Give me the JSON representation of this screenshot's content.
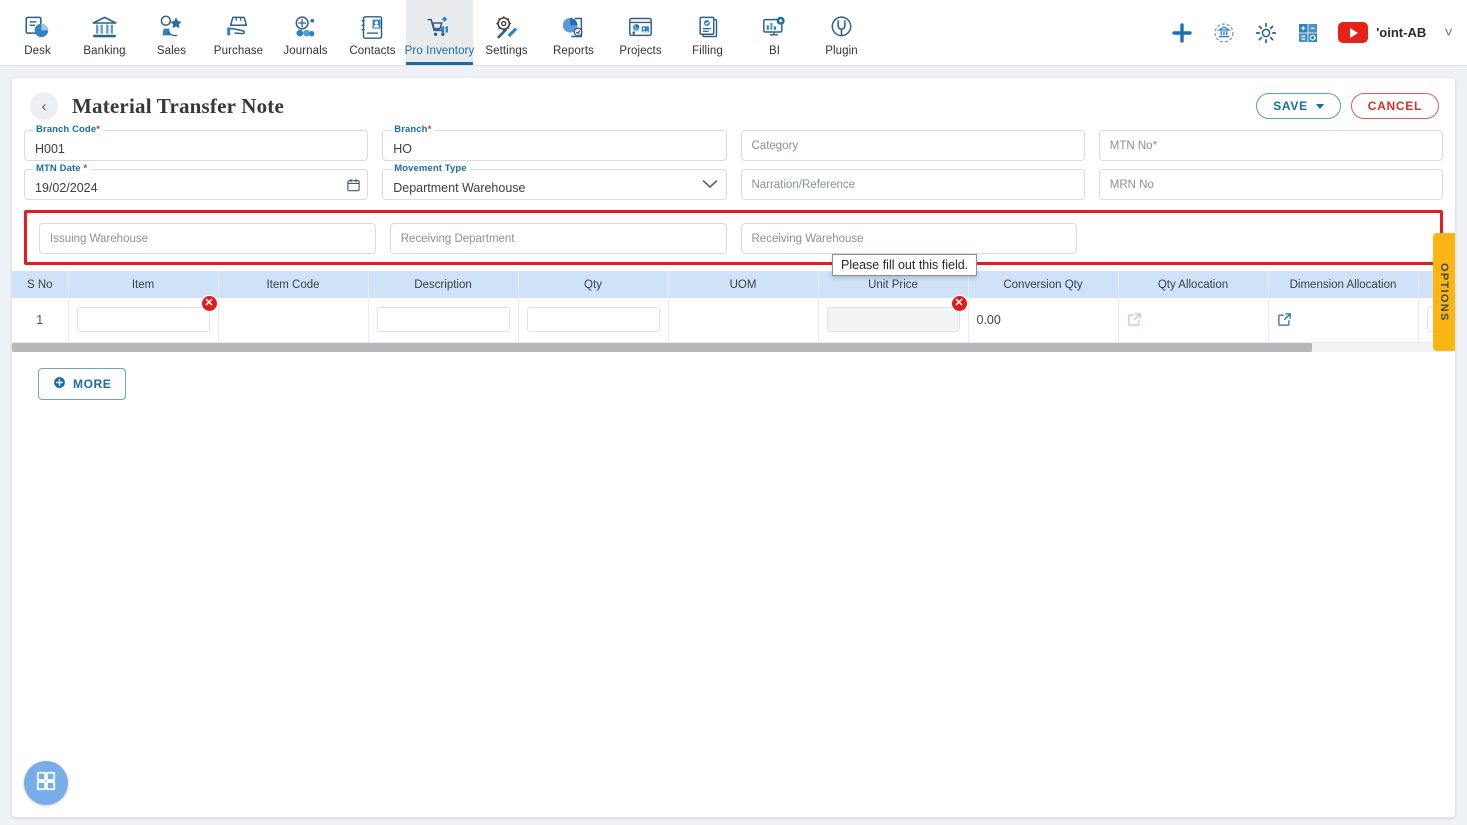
{
  "nav": {
    "items": [
      {
        "label": "Desk",
        "icon": "desk-dashboard-icon"
      },
      {
        "label": "Banking",
        "icon": "bank-icon"
      },
      {
        "label": "Sales",
        "icon": "sales-icon"
      },
      {
        "label": "Purchase",
        "icon": "purchase-icon"
      },
      {
        "label": "Journals",
        "icon": "journals-icon"
      },
      {
        "label": "Contacts",
        "icon": "contacts-icon"
      },
      {
        "label": "Pro Inventory",
        "icon": "inventory-cart-icon",
        "active": true
      },
      {
        "label": "Settings",
        "icon": "settings-tools-icon"
      },
      {
        "label": "Reports",
        "icon": "reports-pie-icon"
      },
      {
        "label": "Projects",
        "icon": "projects-icon"
      },
      {
        "label": "Filling",
        "icon": "filling-docs-icon"
      },
      {
        "label": "BI",
        "icon": "bi-monitor-icon"
      },
      {
        "label": "Plugin",
        "icon": "plugin-icon"
      }
    ],
    "right": {
      "add_icon": "plus-icon",
      "bank_sync_icon": "bank-refresh-icon",
      "settings_icon": "gear-icon",
      "calculator_icon": "calculator-icon",
      "video_icon": "youtube-play-icon",
      "user_label": "'oint-AB",
      "dropdown_icon": "chevron-down-icon"
    }
  },
  "page": {
    "back_icon": "chevron-left-icon",
    "title": "Material Transfer Note",
    "save_label": "SAVE",
    "cancel_label": "CANCEL"
  },
  "form": {
    "branch_code": {
      "label": "Branch Code",
      "required": true,
      "value": "H001"
    },
    "branch": {
      "label": "Branch",
      "required": true,
      "value": "HO"
    },
    "category": {
      "placeholder": "Category"
    },
    "mtn_no": {
      "label": "MTN No",
      "required": true,
      "placeholder": "MTN No"
    },
    "mtn_date": {
      "label": "MTN Date",
      "required": true,
      "value": "19/02/2024",
      "icon": "calendar-icon"
    },
    "movement_type": {
      "label": "Movement Type",
      "value": "Department Warehouse",
      "icon": "chevron-down-icon"
    },
    "narration": {
      "placeholder": "Narration/Reference"
    },
    "mrn_no": {
      "placeholder": "MRN No"
    },
    "issuing_warehouse": {
      "placeholder": "Issuing Warehouse"
    },
    "receiving_department": {
      "placeholder": "Receiving Department"
    },
    "receiving_warehouse": {
      "placeholder": "Receiving Warehouse"
    }
  },
  "tooltip": {
    "text": "Please fill out this field."
  },
  "grid": {
    "columns": [
      "S No",
      "Item",
      "Item Code",
      "Description",
      "Qty",
      "UOM",
      "Unit Price",
      "Conversion Qty",
      "Qty Allocation",
      "Dimension Allocation",
      ""
    ],
    "rows": [
      {
        "s_no": "1",
        "item": "",
        "item_code": "",
        "description": "",
        "qty": "",
        "uom": "",
        "unit_price": "",
        "conversion_qty": "0.00",
        "qty_allocation_icon": "external-link-icon",
        "dimension_allocation_icon": "external-link-icon",
        "item_error_icon": "error-x-icon",
        "uom_error_icon": "error-x-icon"
      }
    ]
  },
  "more_button": {
    "label": "MORE",
    "icon": "plus-circle-icon"
  },
  "options_tab": {
    "label": "OPTIONS"
  },
  "fab": {
    "icon": "apps-grid-icon"
  },
  "colors": {
    "accent": "#1b6ca8",
    "danger": "#d93025",
    "highlight_border": "#e81c1c",
    "table_header": "#cfe2f7",
    "options_tab": "#fcb614"
  }
}
